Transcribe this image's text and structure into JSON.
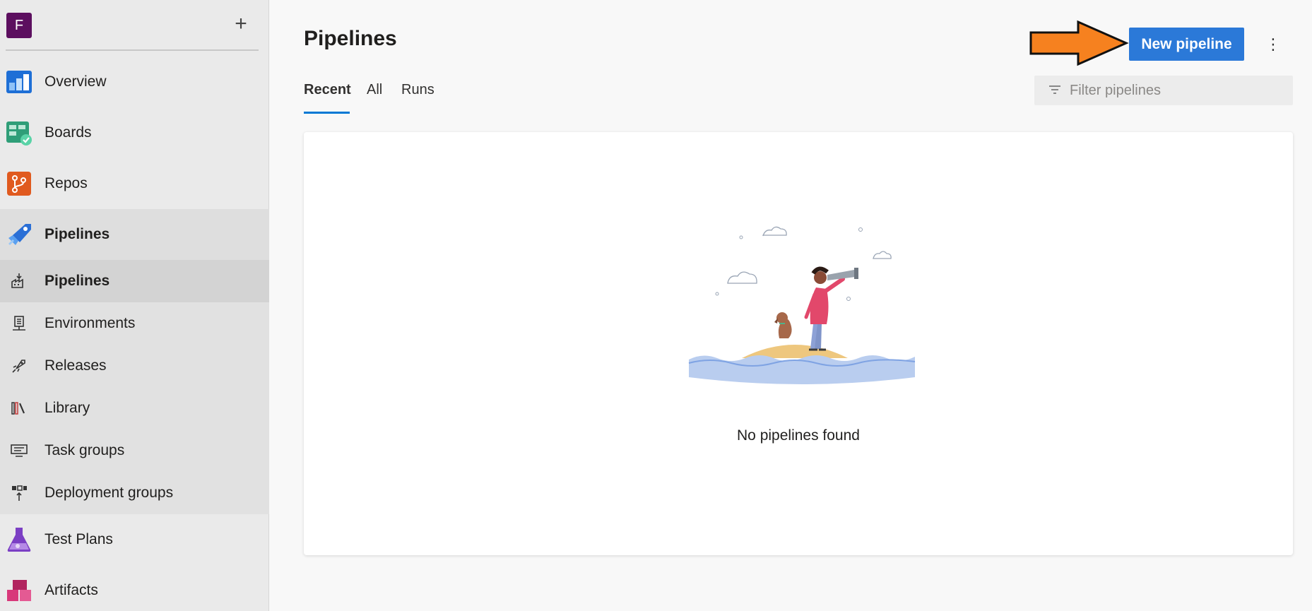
{
  "org": {
    "initial": "F",
    "add_label": "+"
  },
  "sidebar": {
    "items": [
      {
        "label": "Overview",
        "icon": "overview-icon"
      },
      {
        "label": "Boards",
        "icon": "boards-icon"
      },
      {
        "label": "Repos",
        "icon": "repos-icon"
      },
      {
        "label": "Pipelines",
        "icon": "pipelines-icon"
      },
      {
        "label": "Test Plans",
        "icon": "test-plans-icon"
      },
      {
        "label": "Artifacts",
        "icon": "artifacts-icon"
      }
    ],
    "pipelines_sub": [
      {
        "label": "Pipelines",
        "icon": "pipelines-sub-icon"
      },
      {
        "label": "Environments",
        "icon": "environments-icon"
      },
      {
        "label": "Releases",
        "icon": "releases-icon"
      },
      {
        "label": "Library",
        "icon": "library-icon"
      },
      {
        "label": "Task groups",
        "icon": "task-groups-icon"
      },
      {
        "label": "Deployment groups",
        "icon": "deployment-groups-icon"
      }
    ]
  },
  "main": {
    "title": "Pipelines",
    "tabs": [
      {
        "label": "Recent"
      },
      {
        "label": "All"
      },
      {
        "label": "Runs"
      }
    ],
    "new_button_label": "New pipeline",
    "more_label": "⋮",
    "filter": {
      "placeholder": "Filter pipelines",
      "value": ""
    },
    "empty_state": {
      "message": "No pipelines found"
    }
  },
  "colors": {
    "accent": "#2b79d8",
    "org_avatar": "#5c0f5f",
    "arrow": "#f6811f"
  }
}
